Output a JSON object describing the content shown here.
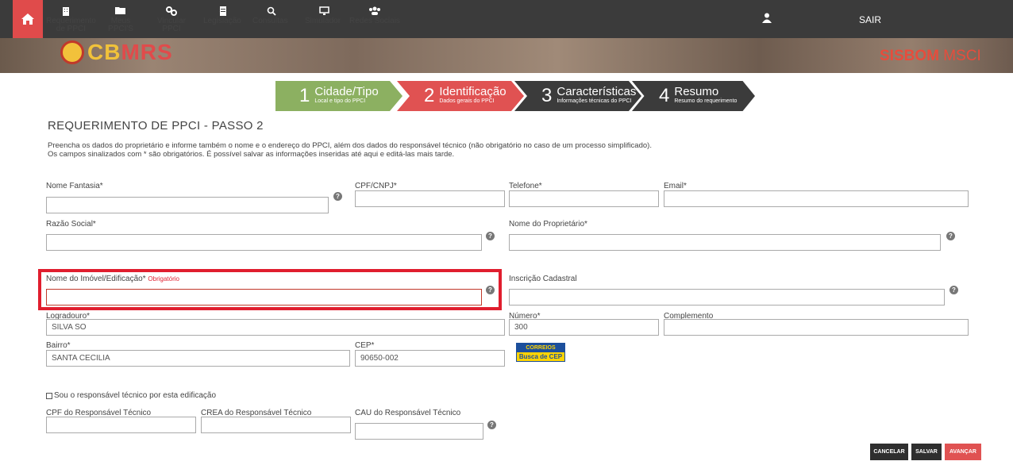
{
  "nav": {
    "items": [
      {
        "icon": "building-icon",
        "label": "Requerimento de PPCI"
      },
      {
        "icon": "folder-icon",
        "label": "Meus PPCI'S"
      },
      {
        "icon": "link-icon",
        "label": "Vincular PPCI"
      },
      {
        "icon": "document-icon",
        "label": "Legislação"
      },
      {
        "icon": "search-icon",
        "label": "Consultas"
      },
      {
        "icon": "monitor-icon",
        "label": "Simulador"
      },
      {
        "icon": "users-icon",
        "label": "Redes Sociais"
      }
    ],
    "logout": "SAIR"
  },
  "brand": {
    "logo_left": "CB",
    "logo_right": "MRS",
    "system": "SISBOM",
    "system_suffix": "MSCI"
  },
  "steps": [
    {
      "num": "1",
      "title": "Cidade/Tipo",
      "subtitle": "Local e tipo do PPCI"
    },
    {
      "num": "2",
      "title": "Identificação",
      "subtitle": "Dados gerais do PPCI"
    },
    {
      "num": "3",
      "title": "Características",
      "subtitle": "Informações técnicas do PPCI"
    },
    {
      "num": "4",
      "title": "Resumo",
      "subtitle": "Resumo do requerimento"
    }
  ],
  "page": {
    "title": "REQUERIMENTO DE PPCI - PASSO 2",
    "intro_line1": "Preencha os dados do proprietário e informe também o nome e o endereço do PPCI, além dos dados do responsável técnico (não obrigatório no caso de um processo simplificado).",
    "intro_line2": "Os campos sinalizados com * são obrigatórios. É possível salvar as informações inseridas até aqui e editá-las mais tarde."
  },
  "fields": {
    "nome_fantasia": {
      "label": "Nome Fantasia*",
      "value": ""
    },
    "cpf_cnpj": {
      "label": "CPF/CNPJ*",
      "value": ""
    },
    "telefone": {
      "label": "Telefone*",
      "value": ""
    },
    "email": {
      "label": "Email*",
      "value": ""
    },
    "razao_social": {
      "label": "Razão Social*",
      "value": ""
    },
    "nome_proprietario": {
      "label": "Nome do Proprietário*",
      "value": ""
    },
    "nome_imovel": {
      "label": "Nome do Imóvel/Edificação*",
      "error": "Obrigatório",
      "value": ""
    },
    "inscricao": {
      "label": "Inscrição Cadastral",
      "value": ""
    },
    "logradouro": {
      "label": "Logradouro*",
      "value": "SILVA SO"
    },
    "numero": {
      "label": "Número*",
      "value": "300"
    },
    "complemento": {
      "label": "Complemento",
      "value": ""
    },
    "bairro": {
      "label": "Bairro*",
      "value": "SANTA CECILIA"
    },
    "cep": {
      "label": "CEP*",
      "value": "90650-002"
    },
    "responsavel_check": {
      "label": "Sou o responsável técnico por esta edificação"
    },
    "cpf_resp": {
      "label": "CPF do Responsável Técnico",
      "value": ""
    },
    "crea_resp": {
      "label": "CREA do Responsável Técnico",
      "value": ""
    },
    "cau_resp": {
      "label": "CAU do Responsável Técnico",
      "value": ""
    }
  },
  "correios": {
    "top": "CORREIOS",
    "bottom": "Busca de CEP"
  },
  "buttons": {
    "cancel": "CANCELAR",
    "save": "SALVAR",
    "next": "AVANÇAR"
  },
  "help_glyph": "?"
}
